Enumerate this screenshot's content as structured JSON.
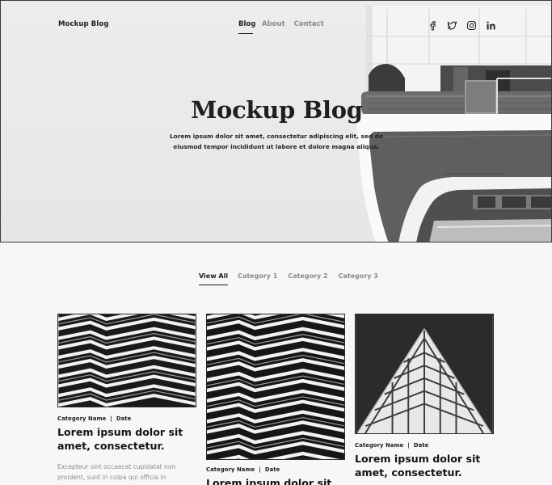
{
  "site": {
    "logo": "Mockup Blog",
    "nav": {
      "blog": "Blog",
      "about": "About",
      "contact": "Contact"
    },
    "social_icons": [
      "facebook-icon",
      "twitter-icon",
      "instagram-icon",
      "linkedin-icon"
    ]
  },
  "hero": {
    "title": "Mockup Blog",
    "subtitle": "Lorem ipsum dolor sit amet, consectetur adipiscing elit, sed do eiusmod tempor incididunt ut labore et dolore magna aliqua."
  },
  "filters": {
    "all": "View All",
    "cat1": "Category 1",
    "cat2": "Category 2",
    "cat3": "Category 3"
  },
  "posts": [
    {
      "meta": "Category Name  |  Date",
      "title": "Lorem ipsum dolor sit amet, consectetur.",
      "excerpt": "Excepteur sint occaecat cupidatat non proident, sunt in culpa qui officia in"
    },
    {
      "meta": "Category Name  |  Date",
      "title": "Lorem ipsum dolor sit"
    },
    {
      "meta": "Category Name  |  Date",
      "title": "Lorem ipsum dolor sit amet, consectetur."
    }
  ],
  "colors": {
    "text": "#1c1c1c",
    "muted": "#8a8a8a",
    "background": "#f7f7f7"
  }
}
